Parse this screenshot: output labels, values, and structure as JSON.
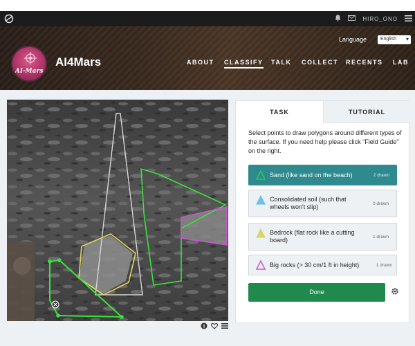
{
  "topbar": {
    "username": "HIRO_ONO"
  },
  "header": {
    "project_title": "AI4Mars",
    "avatar_text": "AI-Mars",
    "language_label": "Language",
    "language_value": "English",
    "nav": [
      "ABOUT",
      "CLASSIFY",
      "TALK",
      "COLLECT",
      "RECENTS",
      "LAB"
    ],
    "active_nav": "CLASSIFY"
  },
  "panel": {
    "tabs": [
      "TASK",
      "TUTORIAL"
    ],
    "instructions": "Select points to draw polygons around different types of the surface. If you need help please click \"Field Guide\" on the right.",
    "options": [
      {
        "label": "Sand (like sand on the beach)",
        "count": "2 drawn",
        "color": "#27c35a",
        "selected": true
      },
      {
        "label": "Consolidated soil (such that wheels won't slip)",
        "count": "0 drawn",
        "color": "#6fc3e6",
        "selected": false
      },
      {
        "label": "Bedrock (flat rock like a cutting board)",
        "count": "1 drawn",
        "color": "#d6d66a",
        "selected": false
      },
      {
        "label": "Big rocks (> 30 cm/1 ft in height)",
        "count": "1 drawn",
        "color": "#c96fd6",
        "selected": false
      }
    ],
    "done_label": "Done"
  },
  "colors": {
    "accent_teal": "#2f8a8f",
    "done_green": "#1f8a4c",
    "sand_polygon": "#39e33f",
    "bedrock_polygon": "#e4d85a",
    "bigrock_polygon": "#d04fd6",
    "selection_outline": "#d8d8d8"
  }
}
